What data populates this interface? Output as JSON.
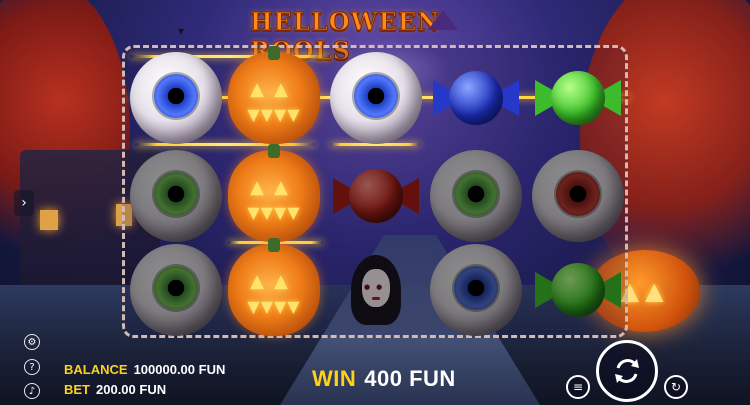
{
  "game": {
    "title": "HELLOWEEN ROOLS"
  },
  "reels": {
    "rows": [
      [
        "blue-eye",
        "pumpkin",
        "blue-eye",
        "blue-candy",
        "green-candy"
      ],
      [
        "green-eye",
        "pumpkin",
        "red-candy",
        "green-eye",
        "red-eye"
      ],
      [
        "green-eye",
        "pumpkin",
        "vampire-girl",
        "blue-eye",
        "green-candy"
      ]
    ]
  },
  "hud": {
    "balance_label": "BALANCE",
    "balance_value": "100000.00 FUN",
    "bet_label": "BET",
    "bet_value": "200.00 FUN",
    "win_label": "WIN",
    "win_value": "400 FUN"
  },
  "icons": {
    "menu": "chevron-right-icon",
    "settings": "gear-icon",
    "help": "help-icon",
    "sound": "speaker-icon",
    "spin": "spin-arrows-icon",
    "stake": "coin-stack-icon",
    "autoplay": "autoplay-icon"
  },
  "colors": {
    "accent": "#ffd21a",
    "payline": "#ffcf33",
    "frame": "#d3b9b4"
  }
}
